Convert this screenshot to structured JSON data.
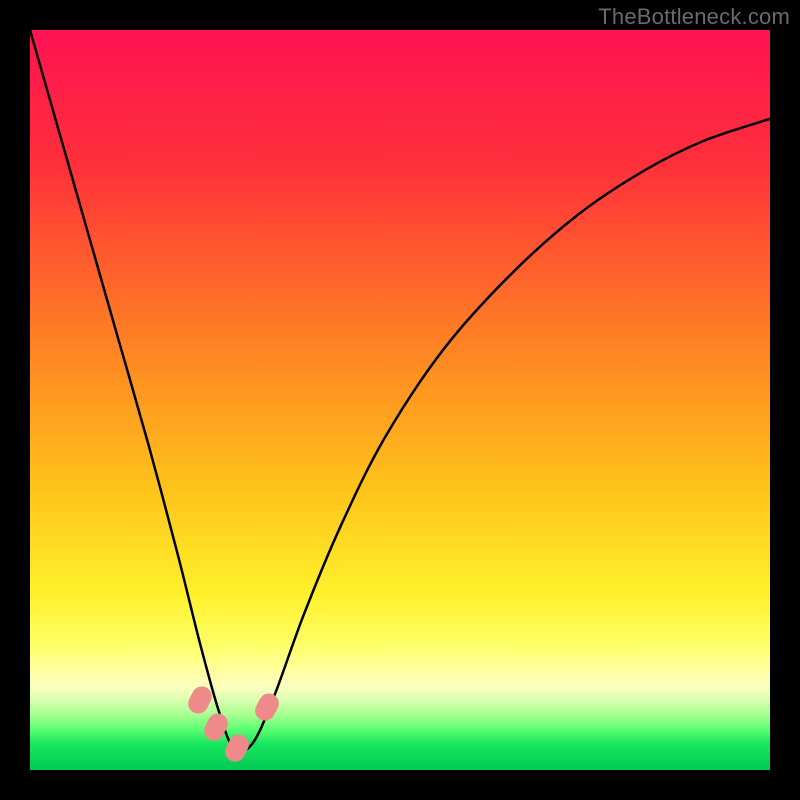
{
  "watermark": "TheBottleneck.com",
  "colors": {
    "frame": "#000000",
    "watermark": "#6a6a6a",
    "blob": "#ef8a8a",
    "curve": "#000000",
    "gradient_stops": [
      {
        "pos": 0.0,
        "color": "#ff1352"
      },
      {
        "pos": 0.18,
        "color": "#ff2f3b"
      },
      {
        "pos": 0.4,
        "color": "#ff7a25"
      },
      {
        "pos": 0.62,
        "color": "#ffc31a"
      },
      {
        "pos": 0.76,
        "color": "#fff02a"
      },
      {
        "pos": 0.83,
        "color": "#ffff66"
      },
      {
        "pos": 0.885,
        "color": "#ffffc0"
      },
      {
        "pos": 0.905,
        "color": "#d9ffb0"
      },
      {
        "pos": 0.925,
        "color": "#a8ff90"
      },
      {
        "pos": 0.945,
        "color": "#5cff72"
      },
      {
        "pos": 0.965,
        "color": "#18e65f"
      },
      {
        "pos": 1.0,
        "color": "#00c955"
      }
    ]
  },
  "chart_data": {
    "type": "line",
    "title": "",
    "xlabel": "",
    "ylabel": "",
    "xlim": [
      0,
      1
    ],
    "ylim": [
      0,
      1
    ],
    "note": "Bottleneck-style V curve on a heatmap gradient; minimum near x≈0.27. y measured as fraction of plot height from bottom (0 = green bottom, 1 = red top). Values are approximate, read from the figure.",
    "series": [
      {
        "name": "curve",
        "x": [
          0.0,
          0.04,
          0.08,
          0.12,
          0.16,
          0.2,
          0.23,
          0.255,
          0.275,
          0.3,
          0.33,
          0.37,
          0.42,
          0.48,
          0.56,
          0.65,
          0.74,
          0.83,
          0.91,
          1.0
        ],
        "y": [
          1.0,
          0.86,
          0.72,
          0.58,
          0.44,
          0.29,
          0.17,
          0.08,
          0.03,
          0.035,
          0.1,
          0.21,
          0.33,
          0.45,
          0.57,
          0.67,
          0.75,
          0.81,
          0.85,
          0.88
        ]
      }
    ],
    "markers": [
      {
        "name": "blob-left-upper",
        "x": 0.23,
        "y": 0.095
      },
      {
        "name": "blob-left-lower",
        "x": 0.252,
        "y": 0.058
      },
      {
        "name": "blob-bottom",
        "x": 0.28,
        "y": 0.03
      },
      {
        "name": "blob-right",
        "x": 0.32,
        "y": 0.085
      }
    ]
  }
}
